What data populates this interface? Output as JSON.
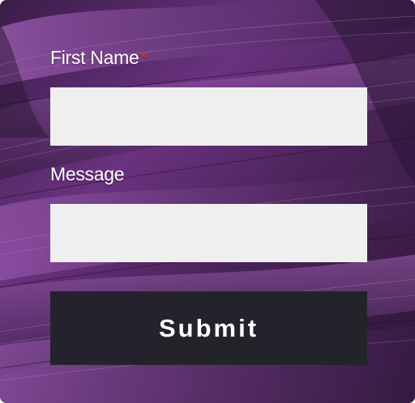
{
  "form": {
    "first_name_label": "First Name",
    "required_marker": "*",
    "first_name_value": "",
    "message_label": "Message",
    "message_value": "",
    "submit_label": "Submit"
  },
  "colors": {
    "background_tint": "#5c2b6e",
    "field_background": "#efefef",
    "button_background": "#23242b",
    "required_marker": "#e0393a",
    "label_text": "#ffffff"
  }
}
